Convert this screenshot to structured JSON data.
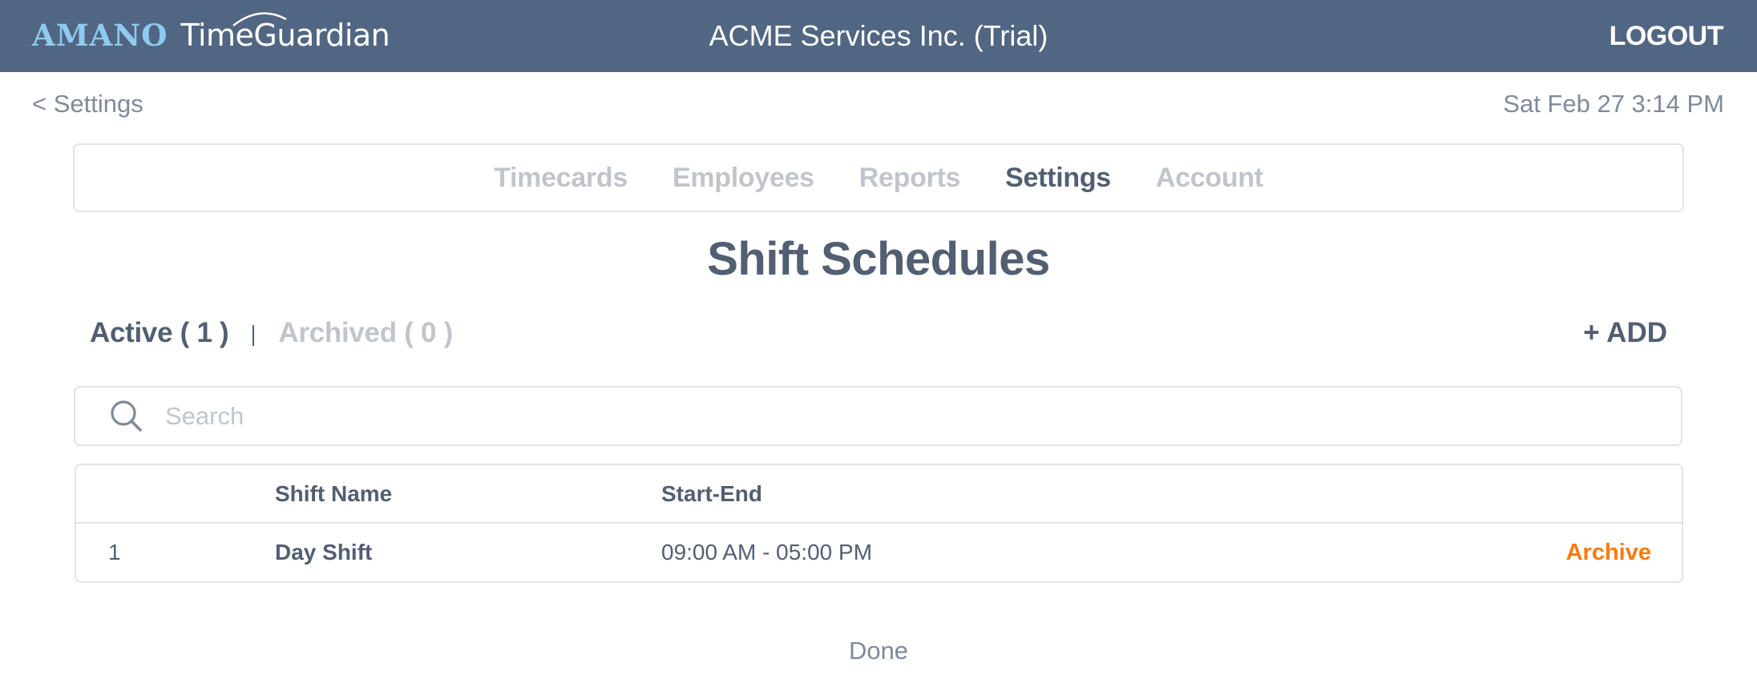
{
  "header": {
    "logo_brand": "AMANO",
    "logo_product": "TimeGuardian",
    "company_name": "ACME Services Inc. (Trial)",
    "logout_label": "LOGOUT"
  },
  "subheader": {
    "back_label": "< Settings",
    "datetime": "Sat Feb 27 3:14 PM"
  },
  "nav": {
    "items": [
      {
        "label": "Timecards",
        "active": false
      },
      {
        "label": "Employees",
        "active": false
      },
      {
        "label": "Reports",
        "active": false
      },
      {
        "label": "Settings",
        "active": true
      },
      {
        "label": "Account",
        "active": false
      }
    ]
  },
  "page": {
    "title": "Shift Schedules"
  },
  "tabs": {
    "active_label": "Active ( 1 )",
    "archived_label": "Archived ( 0 )",
    "add_label": "+ ADD"
  },
  "search": {
    "icon": "search-icon",
    "placeholder": "Search",
    "value": ""
  },
  "table": {
    "columns": [
      "",
      "Shift Name",
      "Start-End",
      ""
    ],
    "rows": [
      {
        "index": "1",
        "name": "Day Shift",
        "start_end": "09:00 AM - 05:00 PM",
        "action": "Archive"
      }
    ]
  },
  "footer": {
    "done_label": "Done"
  },
  "colors": {
    "header_bg": "#516682",
    "brand_light_blue": "#8ecbf0",
    "text_primary": "#525e71",
    "text_muted": "#c1c5cb",
    "text_secondary": "#7f8a9b",
    "accent_orange": "#ff7a0b",
    "border": "#e1e3e7"
  }
}
